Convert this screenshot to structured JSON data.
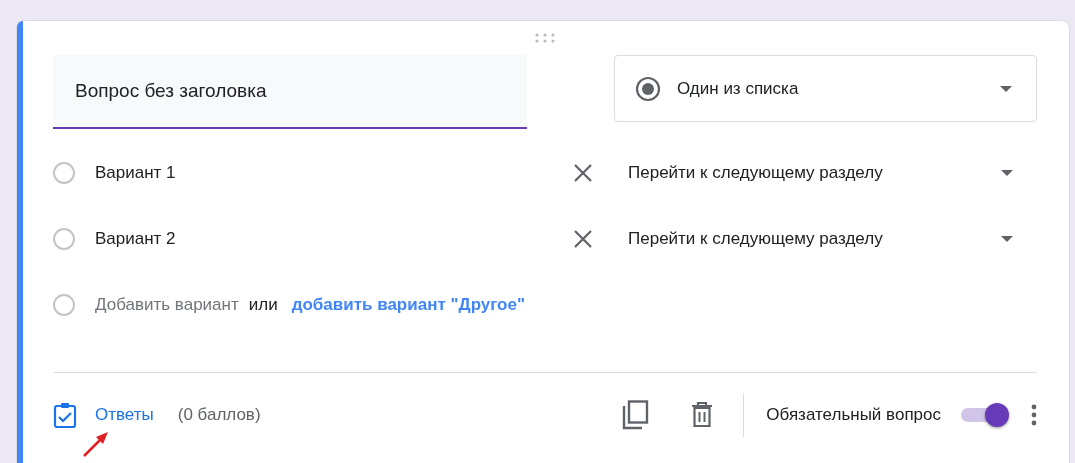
{
  "question": {
    "title": "Вопрос без заголовка",
    "type": "Один из списка"
  },
  "options": [
    {
      "label": "Вариант 1",
      "checked": false,
      "goto": "Перейти к следующему разделу"
    },
    {
      "label": "Вариант 2",
      "checked": false,
      "goto": "Перейти к следующему разделу"
    }
  ],
  "add_option": {
    "checked": false,
    "placeholder": "Добавить вариант",
    "or": "или",
    "link": "добавить вариант \"Другое\""
  },
  "footer": {
    "answers": "Ответы",
    "points": "(0 баллов)",
    "required_label": "Обязательный вопрос",
    "required": true
  }
}
